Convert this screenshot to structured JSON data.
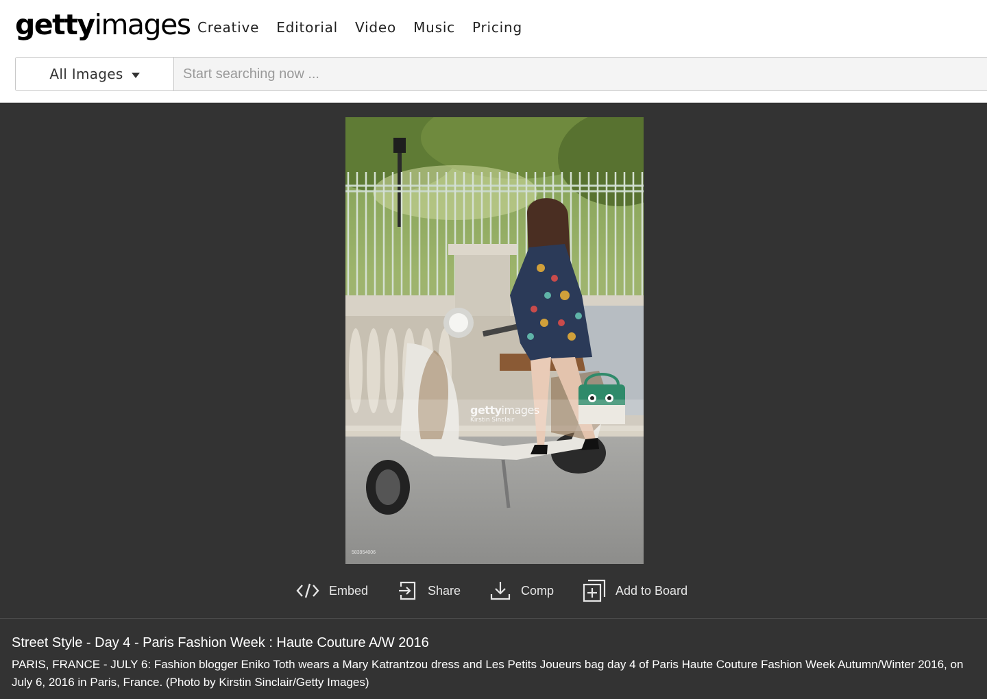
{
  "header": {
    "logo": {
      "bold": "getty",
      "light": "images"
    },
    "nav": [
      "Creative",
      "Editorial",
      "Video",
      "Music",
      "Pricing"
    ]
  },
  "search": {
    "scope_label": "All Images",
    "placeholder": "Start searching now ..."
  },
  "photo": {
    "watermark_brand_bold": "getty",
    "watermark_brand_light": "images",
    "watermark_credit": "Kirstin Sinclair",
    "image_id": "583954006"
  },
  "actions": [
    {
      "label": "Embed",
      "icon": "code-icon"
    },
    {
      "label": "Share",
      "icon": "share-icon"
    },
    {
      "label": "Comp",
      "icon": "download-icon"
    },
    {
      "label": "Add to Board",
      "icon": "add-board-icon"
    }
  ],
  "caption": {
    "title": "Street Style - Day 4 - Paris Fashion Week : Haute Couture A/W 2016",
    "body": "PARIS, FRANCE - JULY 6: Fashion blogger Eniko Toth wears a Mary Katrantzou dress and Les Petits Joueurs bag day 4 of Paris Haute Couture Fashion Week Autumn/Winter 2016, on July 6, 2016 in Paris, France. (Photo by Kirstin Sinclair/Getty Images)"
  },
  "colors": {
    "page_bg": "#333333",
    "header_bg": "#ffffff",
    "text_light": "#e6e6e6"
  }
}
